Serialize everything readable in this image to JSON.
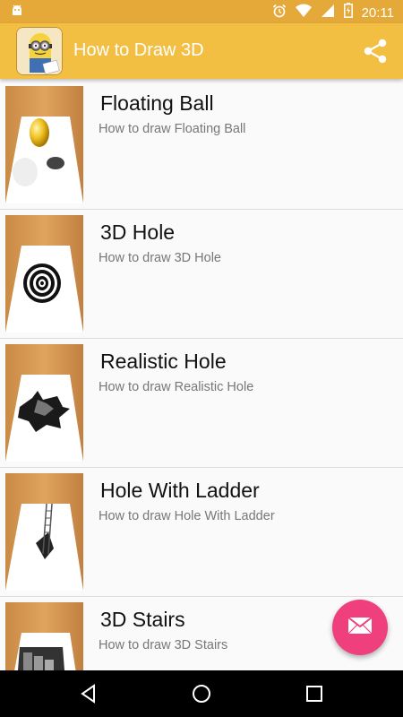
{
  "status_bar": {
    "time": "20:11"
  },
  "app_bar": {
    "title": "How to Draw 3D",
    "share_icon": "share-icon",
    "logo_icon": "minion-drawing-logo"
  },
  "items": [
    {
      "title": "Floating Ball",
      "subtitle": "How to draw Floating Ball"
    },
    {
      "title": "3D Hole",
      "subtitle": "How to draw 3D Hole"
    },
    {
      "title": "Realistic Hole",
      "subtitle": "How to draw Realistic Hole"
    },
    {
      "title": "Hole With Ladder",
      "subtitle": "How to draw Hole With Ladder"
    },
    {
      "title": "3D Stairs",
      "subtitle": "How to draw 3D Stairs"
    }
  ],
  "fab": {
    "icon": "mail-icon"
  },
  "nav": {
    "back": "back-icon",
    "home": "home-icon",
    "recents": "recents-icon"
  },
  "colors": {
    "status_bar": "#e5a93a",
    "app_bar": "#f2bf43",
    "fab": "#ef3f7c"
  }
}
